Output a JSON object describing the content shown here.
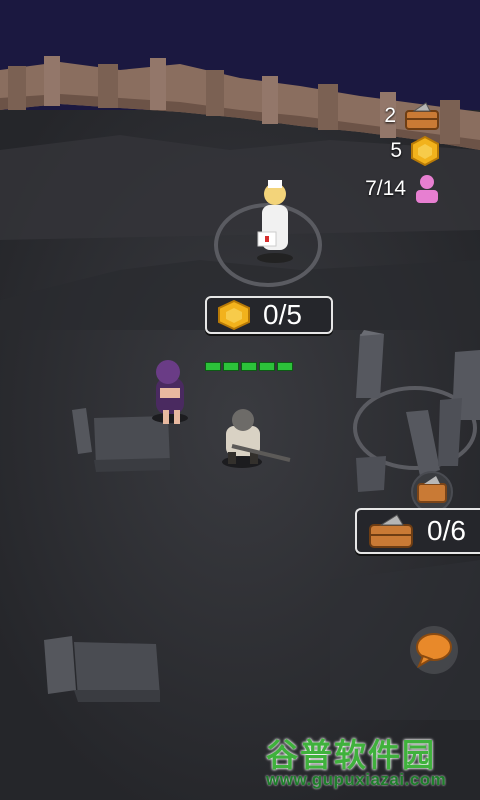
{
  "hud": {
    "crates": {
      "value": "2",
      "icon": "crate-icon"
    },
    "coins": {
      "value": "5",
      "icon": "gold-hex-coin-icon"
    },
    "population": {
      "value": "7/14",
      "icon": "person-icon",
      "color": "#e77fd1"
    }
  },
  "coin_counter": {
    "value": "0/5",
    "icon": "gold-hex-coin-icon"
  },
  "crate_counter": {
    "value": "0/6",
    "icon": "crate-icon"
  },
  "player": {
    "health_segments_filled": 5,
    "health_segments_total": 5,
    "health_color": "#2cc23a"
  },
  "chat_button": {
    "icon": "speech-bubble-icon",
    "color": "#e8892a"
  },
  "watermark": {
    "title": "谷普软件园",
    "url": "www.gupuxiazai.com"
  },
  "colors": {
    "sky": "#1b1840",
    "ground": "#2c2d31",
    "fence": "#8a6e5f",
    "coin": "#f2b21c",
    "crate": "#c97a35"
  }
}
